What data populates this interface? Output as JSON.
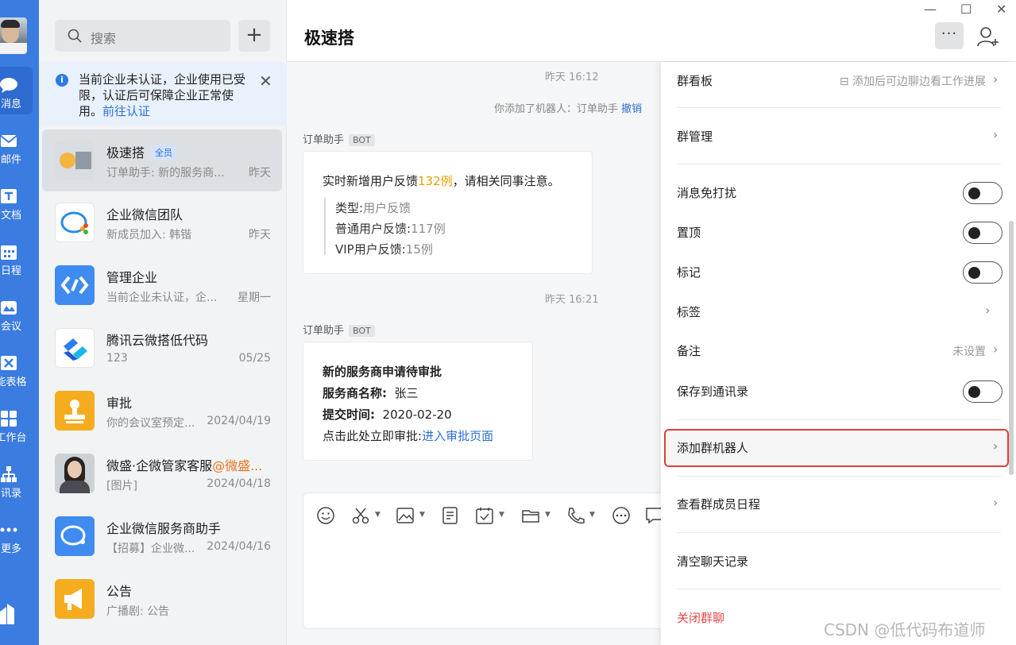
{
  "rail": {
    "items": [
      {
        "label": "消息",
        "icon": "message-icon"
      },
      {
        "label": "邮件",
        "icon": "mail-icon"
      },
      {
        "label": "文档",
        "icon": "document-icon"
      },
      {
        "label": "日程",
        "icon": "calendar-icon"
      },
      {
        "label": "会议",
        "icon": "meeting-icon"
      },
      {
        "label": "能表格",
        "icon": "smart-sheet-icon"
      },
      {
        "label": "工作台",
        "icon": "workbench-icon"
      },
      {
        "label": "讯录",
        "icon": "contacts-icon"
      },
      {
        "label": "更多",
        "icon": "more-icon"
      }
    ]
  },
  "sidebar": {
    "search_placeholder": "搜索",
    "add_label": "+",
    "notice": {
      "text": "当前企业未认证，企业使用已受限，认证后可保障企业正常使",
      "text2": "用。",
      "link": "前往认证"
    },
    "conversations": [
      {
        "name": "极速搭",
        "badge": "全员",
        "preview": "订单助手: 新的服务商...",
        "time": "昨天"
      },
      {
        "name": "企业微信团队",
        "preview": "新成员加入: 韩锴",
        "time": "昨天"
      },
      {
        "name": "管理企业",
        "preview": "当前企业未认证，企...",
        "time": "星期一"
      },
      {
        "name": "腾讯云微搭低代码",
        "preview": "123",
        "time": "05/25"
      },
      {
        "name": "审批",
        "preview": "你的会议室预定...",
        "time": "2024/04/19"
      },
      {
        "name": "微盛·企微管家客服",
        "name_highlight": "@微盛...",
        "preview": "[图片]",
        "time": "2024/04/18"
      },
      {
        "name": "企业微信服务商助手",
        "preview": "【招募】企业微...",
        "time": "2024/04/16"
      },
      {
        "name": "公告",
        "preview": "广播剧: 公告",
        "time": ""
      }
    ]
  },
  "chat": {
    "title": "极速搭",
    "more_label": "···",
    "timestamp1": "昨天 16:12",
    "system_msg": "你添加了机器人：订单助手",
    "system_link": "撤销",
    "sender1": "订单助手",
    "bot_tag": "BOT",
    "msg1": {
      "prefix": "实时新增用户反馈",
      "count": "132例",
      "suffix": "，请相关同事注意。",
      "rows": [
        {
          "k": "类型:",
          "v": "用户反馈"
        },
        {
          "k": "普通用户反馈:",
          "v": "117例"
        },
        {
          "k": "VIP用户反馈:",
          "v": "15例"
        }
      ]
    },
    "timestamp2": "昨天 16:21",
    "sender2": "订单助手",
    "msg2": {
      "title": "新的服务商申请待审批",
      "name_label": "服务商名称:",
      "name_value": "张三",
      "time_label": "提交时间:",
      "time_value": "2020-02-20",
      "action_text": "点击此处立即审批:",
      "action_link": "进入审批页面"
    }
  },
  "panel": {
    "board_label": "群看板",
    "board_hint": "添加后可边聊边看工作进展",
    "manage_label": "群管理",
    "mute_label": "消息免打扰",
    "pin_label": "置顶",
    "mark_label": "标记",
    "tag_label": "标签",
    "remark_label": "备注",
    "remark_hint": "未设置",
    "save_contacts_label": "保存到通讯录",
    "add_robot_label": "添加群机器人",
    "schedule_label": "查看群成员日程",
    "clear_label": "清空聊天记录",
    "close_label": "关闭群聊"
  },
  "watermark": "CSDN @低代码布道师",
  "colors": {
    "accent": "#3a7ce0",
    "link": "#2e6fd6",
    "highlight_border": "#d9413a",
    "danger": "#e24a4a"
  }
}
